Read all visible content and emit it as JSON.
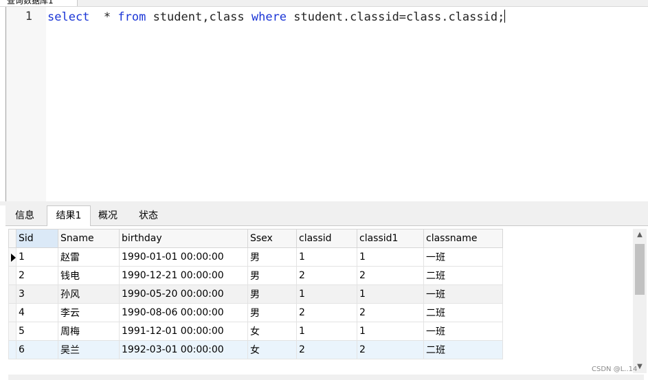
{
  "top_tab": {
    "label": "查询数据库1"
  },
  "editor": {
    "line_number": "1",
    "tokens": [
      "select",
      "  * ",
      "from",
      " student,class ",
      "where",
      " student.classid=class.classid;"
    ]
  },
  "result_tabs": [
    "信息",
    "结果1",
    "概况",
    "状态"
  ],
  "grid": {
    "columns": [
      "Sid",
      "Sname",
      "birthday",
      "Ssex",
      "classid",
      "classid1",
      "classname"
    ],
    "rows": [
      [
        "1",
        "赵雷",
        "1990-01-01 00:00:00",
        "男",
        "1",
        "1",
        "一班"
      ],
      [
        "2",
        "钱电",
        "1990-12-21 00:00:00",
        "男",
        "2",
        "2",
        "二班"
      ],
      [
        "3",
        "孙风",
        "1990-05-20 00:00:00",
        "男",
        "1",
        "1",
        "一班"
      ],
      [
        "4",
        "李云",
        "1990-08-06 00:00:00",
        "男",
        "2",
        "2",
        "二班"
      ],
      [
        "5",
        "周梅",
        "1991-12-01 00:00:00",
        "女",
        "1",
        "1",
        "一班"
      ],
      [
        "6",
        "吴兰",
        "1992-03-01 00:00:00",
        "女",
        "2",
        "2",
        "二班"
      ]
    ]
  },
  "scrollbar": {
    "up_icon": "chevron-up-icon",
    "down_icon": "chevron-down-icon"
  },
  "watermark": "CSDN @L..14"
}
